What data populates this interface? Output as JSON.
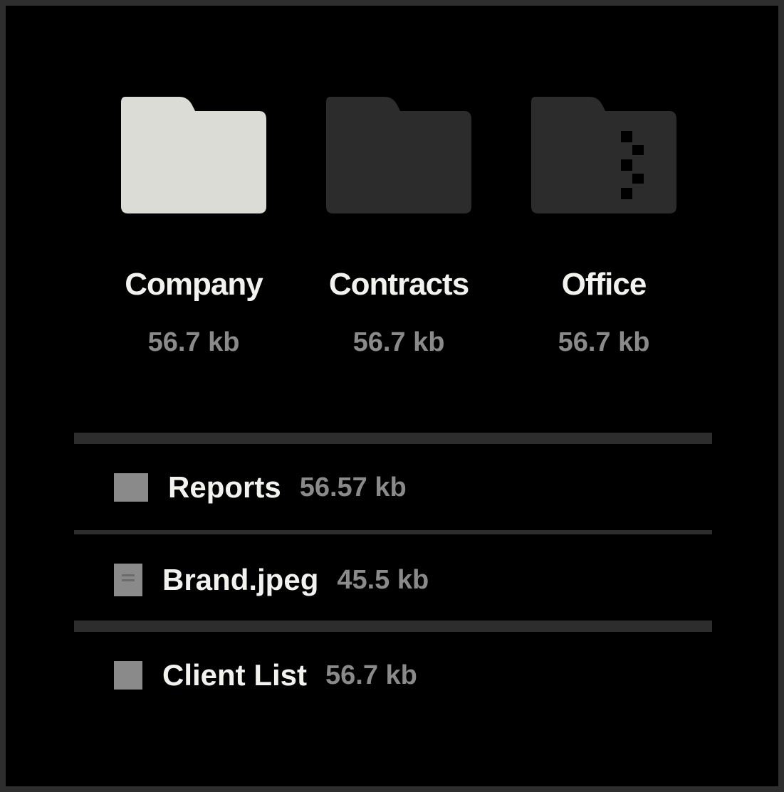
{
  "folders": [
    {
      "name": "Company",
      "size": "56.7 kb",
      "icon": "folder-icon",
      "color": "#dcdcd6"
    },
    {
      "name": "Contracts",
      "size": "56.7 kb",
      "icon": "folder-icon",
      "color": "#2c2c2c"
    },
    {
      "name": "Office",
      "size": "56.7 kb",
      "icon": "zip-folder-icon",
      "color": "#2c2c2c"
    }
  ],
  "files": [
    {
      "name": "Reports",
      "size": "56.57 kb",
      "icon": "document-icon"
    },
    {
      "name": "Brand.jpeg",
      "size": "45.5 kb",
      "icon": "image-file-icon"
    },
    {
      "name": "Client List",
      "size": "56.7 kb",
      "icon": "document-icon"
    }
  ],
  "colors": {
    "background": "#000000",
    "frame_border": "#2e2e2e",
    "divider": "#2d2d2d",
    "primary_text": "#f2f2ee",
    "secondary_text": "#8a8a8a"
  }
}
